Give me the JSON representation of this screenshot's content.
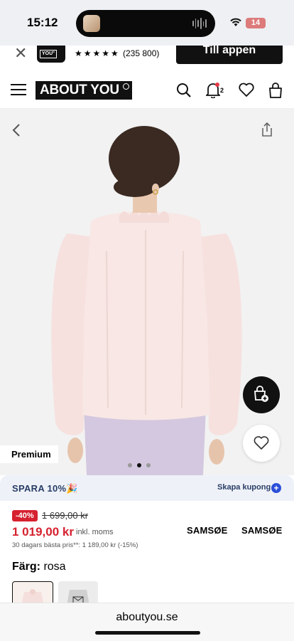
{
  "status_bar": {
    "time": "15:12",
    "battery": "14"
  },
  "app_banner": {
    "close_icon": "close-icon",
    "logo_text": "ABOUT YOU",
    "stars": "★★★★★",
    "rating_count": "(235 800)",
    "open_label": "Till appen"
  },
  "header": {
    "logo": "ABOUT YOU",
    "notification_count": "2"
  },
  "product_image": {
    "label": "Premium"
  },
  "promo": {
    "text": "SPARA 10%🎉",
    "link": "Skapa kupong"
  },
  "price": {
    "discount": "-40%",
    "old": "1 699,00 kr",
    "current": "1 019,00 kr",
    "vat_note": "inkl. moms",
    "best_price_note": "30 dagars bästa pris**: 1 189,00 kr (-15%)",
    "brand_1": "SAMSØE",
    "brand_2": "SAMSØE"
  },
  "color": {
    "label": "Färg:",
    "value": "rosa"
  },
  "browser": {
    "url": "aboutyou.se"
  },
  "colors": {
    "price_red": "#d6212f",
    "promo_bg": "#eef2f8",
    "accent_blue": "#2b4fd8"
  }
}
